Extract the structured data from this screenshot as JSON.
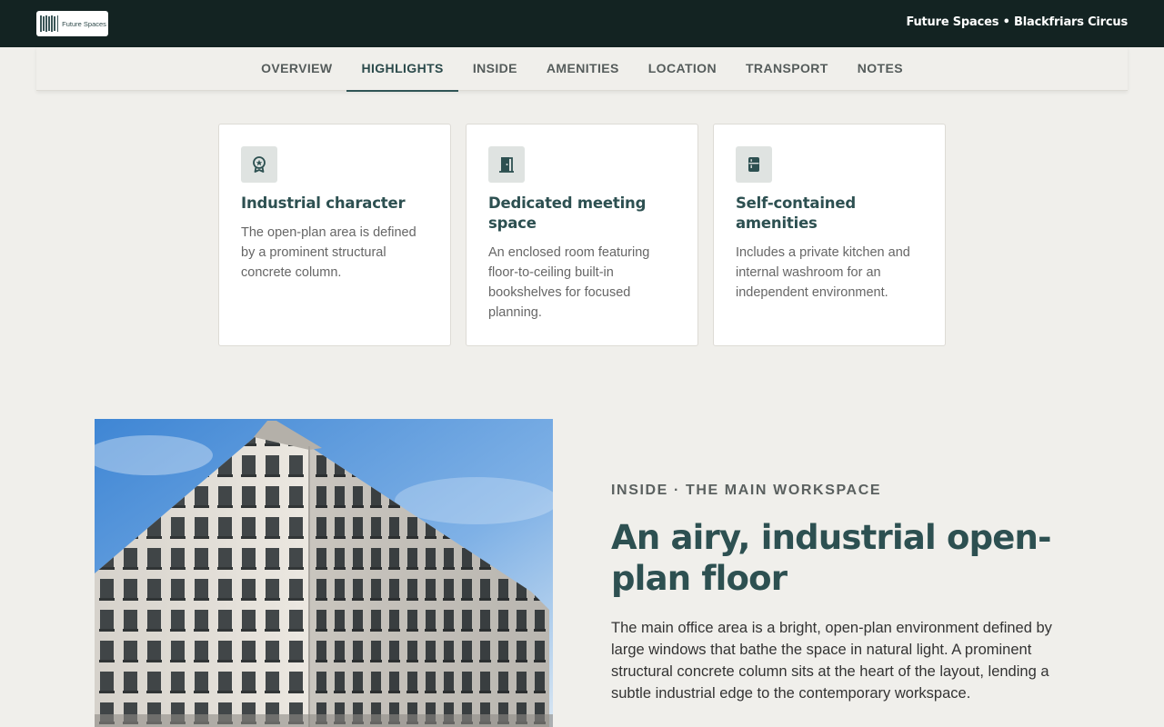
{
  "header": {
    "logo_text": "Future Spaces",
    "title": "Future Spaces • Blackfriars Circus"
  },
  "nav": {
    "items": [
      {
        "label": "OVERVIEW",
        "active": false
      },
      {
        "label": "HIGHLIGHTS",
        "active": true
      },
      {
        "label": "INSIDE",
        "active": false
      },
      {
        "label": "AMENITIES",
        "active": false
      },
      {
        "label": "LOCATION",
        "active": false
      },
      {
        "label": "TRANSPORT",
        "active": false
      },
      {
        "label": "NOTES",
        "active": false
      }
    ]
  },
  "highlights": [
    {
      "icon": "award-icon",
      "title": "Industrial character",
      "text": "The open-plan area is defined by a prominent structural concrete column."
    },
    {
      "icon": "door-icon",
      "title": "Dedicated meeting space",
      "text": "An enclosed room featuring floor-to-ceiling built-in bookshelves for focused planning."
    },
    {
      "icon": "fridge-icon",
      "title": "Self-contained amenities",
      "text": "Includes a private kitchen and internal washroom for an independent environment."
    }
  ],
  "inside": {
    "eyebrow": "INSIDE · THE MAIN WORKSPACE",
    "title": "An airy, industrial open-plan floor",
    "body": "The main office area is a bright, open-plan environment defined by large windows that bathe the space in natural light. A prominent structural concrete column sits at the heart of the layout, lending a subtle industrial edge to the contemporary workspace."
  },
  "colors": {
    "header_bg": "#132322",
    "accent": "#2d5051",
    "page_bg": "#f0efeb",
    "icon_bg": "#dfe3e1"
  }
}
